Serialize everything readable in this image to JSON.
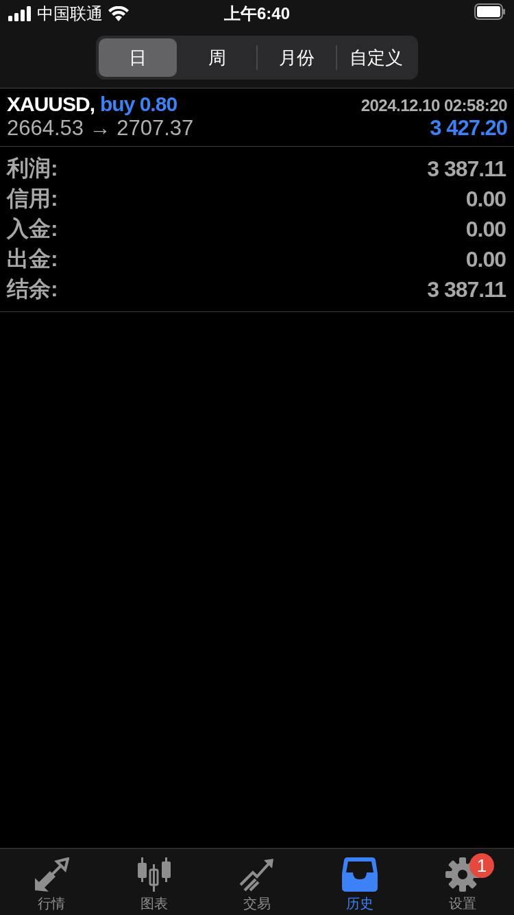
{
  "status_bar": {
    "carrier": "中国联通",
    "time": "上午6:40"
  },
  "period_tabs": [
    {
      "label": "日",
      "selected": true
    },
    {
      "label": "周",
      "selected": false
    },
    {
      "label": "月份",
      "selected": false
    },
    {
      "label": "自定义",
      "selected": false
    }
  ],
  "deal": {
    "symbol": "XAUUSD,",
    "side": "buy 0.80",
    "time": "2024.12.10 02:58:20",
    "prices": "2664.53 → 2707.37",
    "profit": "3 427.20"
  },
  "summary": [
    {
      "label": "利润:",
      "value": "3 387.11"
    },
    {
      "label": "信用:",
      "value": "0.00"
    },
    {
      "label": "入金:",
      "value": "0.00"
    },
    {
      "label": "出金:",
      "value": "0.00"
    },
    {
      "label": "结余:",
      "value": "3 387.11"
    }
  ],
  "tab_bar": [
    {
      "kind": "quotes",
      "label": "行情",
      "selected": false
    },
    {
      "kind": "chart",
      "label": "图表",
      "selected": false
    },
    {
      "kind": "trade",
      "label": "交易",
      "selected": false
    },
    {
      "kind": "history",
      "label": "历史",
      "selected": true
    },
    {
      "kind": "settings",
      "label": "设置",
      "selected": false,
      "badge": "1"
    }
  ]
}
